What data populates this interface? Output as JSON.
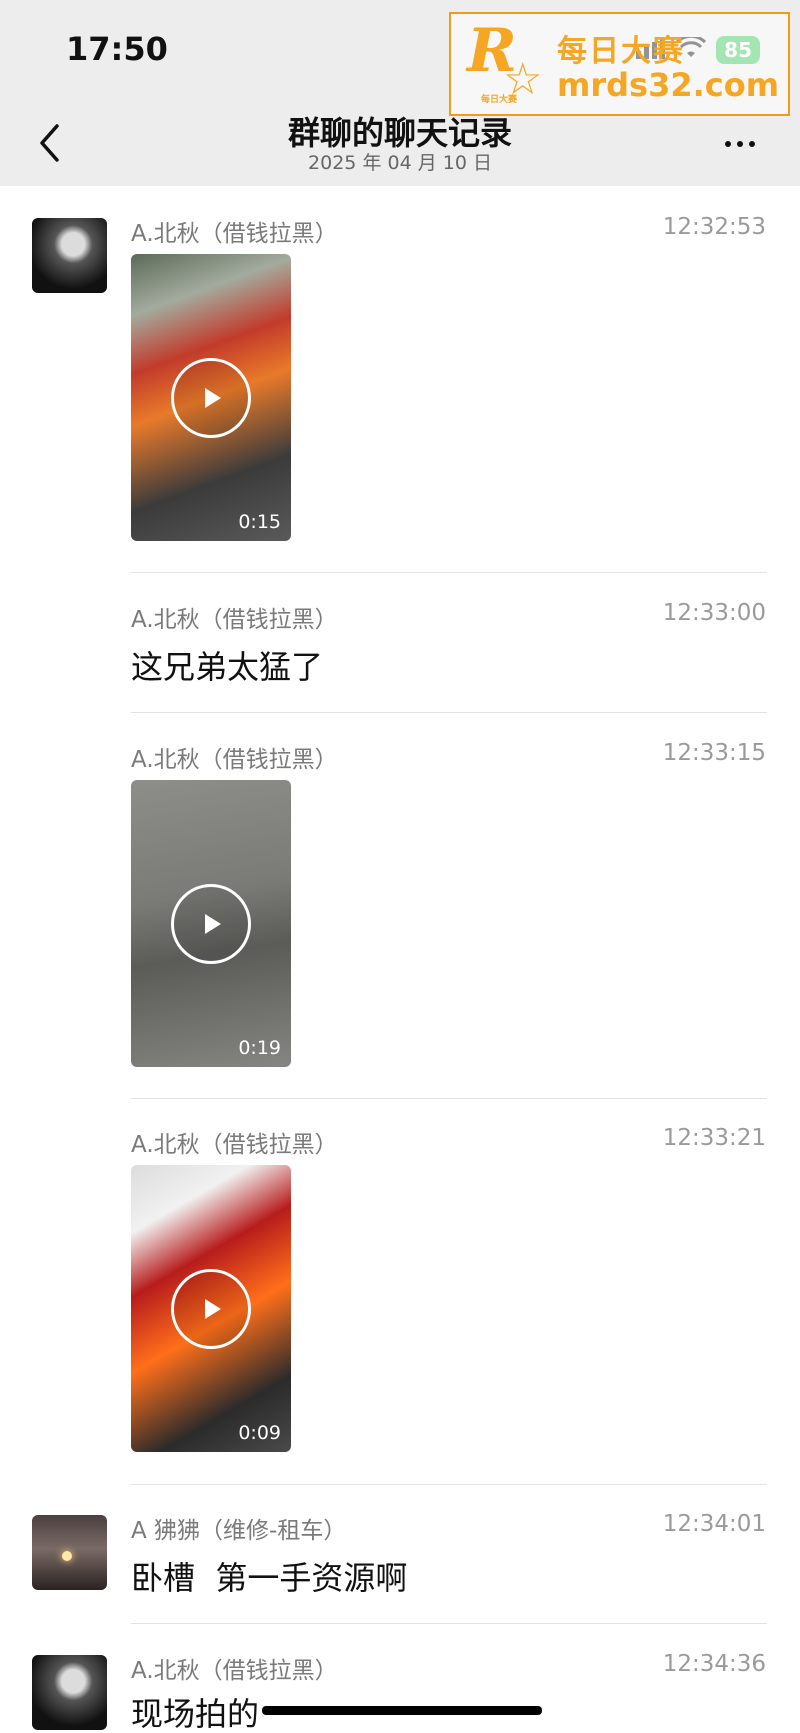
{
  "status_bar": {
    "time": "17:50",
    "battery": "85"
  },
  "watermark": {
    "title": "每日大赛",
    "url": "mrds32.com",
    "logo_small_text": "每日大赛"
  },
  "nav": {
    "title": "群聊的聊天记录",
    "subtitle": "2025 年 04 月 10 日",
    "back_icon": "chevron-left-icon",
    "more_icon": "more-dots-icon"
  },
  "messages": [
    {
      "sender": "A.北秋（借钱拉黑）",
      "time": "12:32:53",
      "type": "video",
      "duration": "0:15"
    },
    {
      "sender": "A.北秋（借钱拉黑）",
      "time": "12:33:00",
      "type": "text",
      "text": "这兄弟太猛了"
    },
    {
      "sender": "A.北秋（借钱拉黑）",
      "time": "12:33:15",
      "type": "video",
      "duration": "0:19"
    },
    {
      "sender": "A.北秋（借钱拉黑）",
      "time": "12:33:21",
      "type": "video",
      "duration": "0:09"
    },
    {
      "sender": "A 狒狒（维修-租车）",
      "time": "12:34:01",
      "type": "text",
      "text": "卧槽  第一手资源啊"
    },
    {
      "sender": "A.北秋（借钱拉黑）",
      "time": "12:34:36",
      "type": "text",
      "text": "现场拍的"
    }
  ],
  "colors": {
    "header_bg": "#ededed",
    "watermark": "#f5a623",
    "battery": "#34c759"
  }
}
